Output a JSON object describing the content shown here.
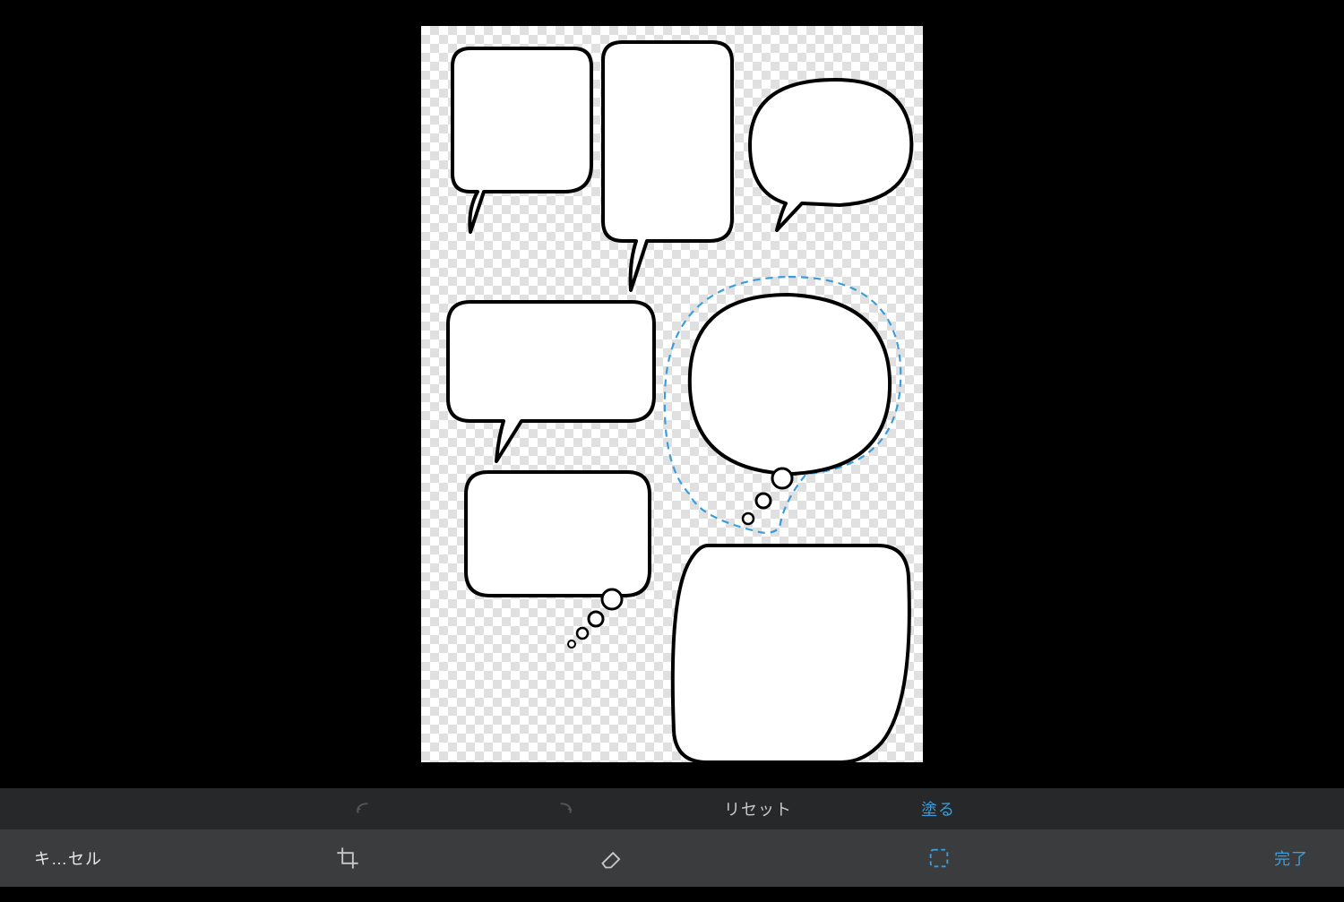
{
  "toolbar_upper": {
    "undo_label": "undo",
    "redo_label": "redo",
    "reset_label": "リセット",
    "fill_mode_label": "塗る"
  },
  "toolbar_lower": {
    "cancel_label": "キ…セル",
    "crop_label": "crop",
    "eraser_label": "eraser",
    "select_label": "selection",
    "done_label": "完了"
  },
  "state": {
    "active_tool": "selection",
    "fill_mode_active": true,
    "undo_enabled": false,
    "redo_enabled": false
  },
  "canvas": {
    "selection_color": "#3b9ddb",
    "selection_dash": "8 6",
    "bubbles_count": 7,
    "selected_bubble_index": 4
  }
}
